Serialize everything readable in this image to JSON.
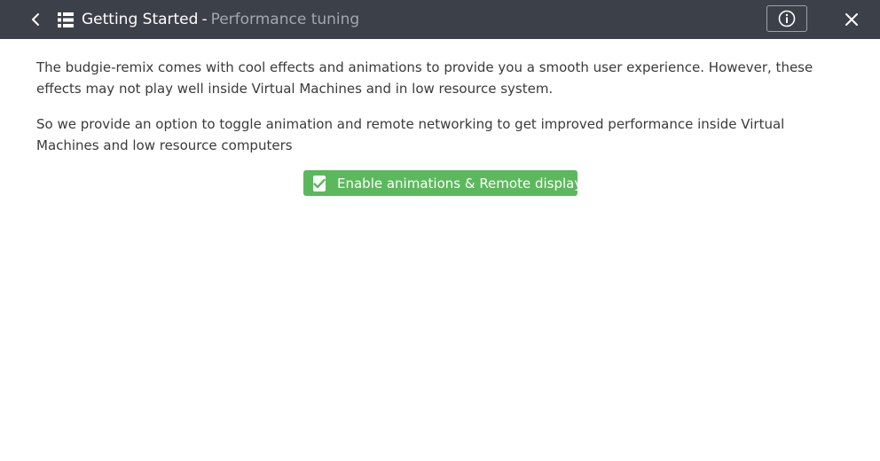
{
  "window": {
    "title_main": "Getting Started",
    "title_separator": "-",
    "title_sub": "Performance tuning"
  },
  "icons": {
    "back": "chevron-left-icon",
    "menu": "list-icon",
    "info": "info-icon",
    "close": "close-icon",
    "checkbox": "check-icon"
  },
  "content": {
    "paragraph_1": "The budgie-remix comes with cool effects and animations to provide you a smooth user experience. However, these effects may not play well inside Virtual Machines and in low resource system.",
    "paragraph_2": "So we provide an option to toggle animation and remote networking to get improved performance inside Virtual Machines and low resource computers"
  },
  "toggle": {
    "label": "Enable animations & Remote display",
    "checked": true
  },
  "colors": {
    "titlebar": "#3c4049",
    "accent_green": "#5cb85c",
    "subtitle_gray": "#a4a7ad",
    "body_text": "#3a3a3a"
  }
}
